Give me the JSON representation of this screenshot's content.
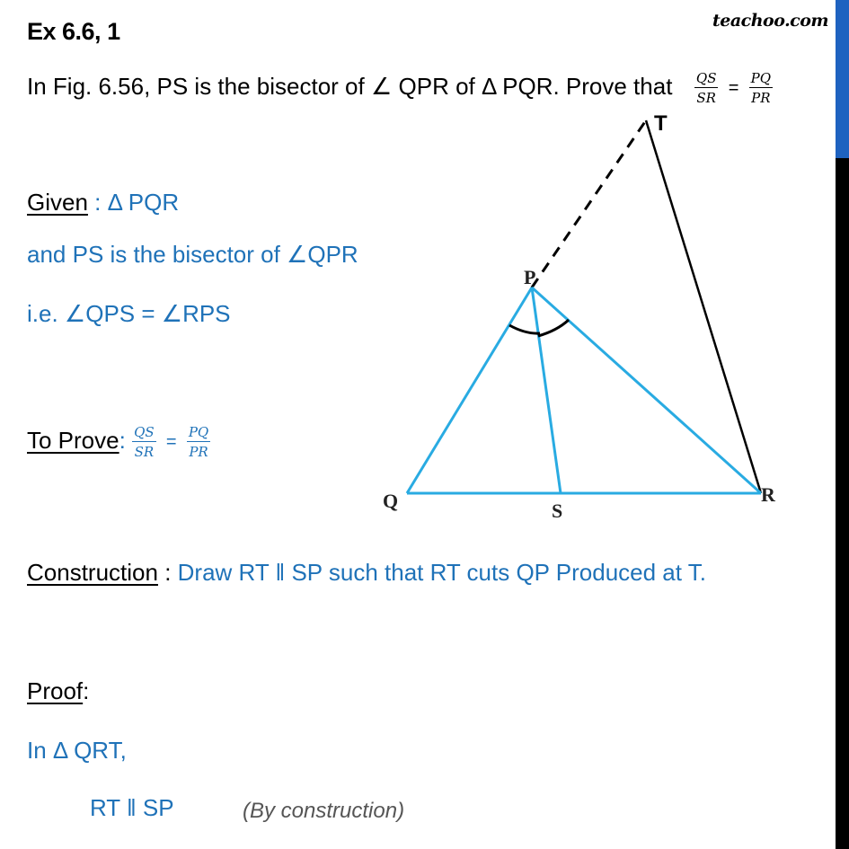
{
  "header": {
    "title": "Ex 6.6, 1",
    "brand": "teachoo.com"
  },
  "question": {
    "text": "In Fig. 6.56, PS is the bisector of ∠ QPR of Δ PQR. Prove that",
    "fraction_left": {
      "num": "QS",
      "den": "SR"
    },
    "equals": "=",
    "fraction_right": {
      "num": "PQ",
      "den": "PR"
    }
  },
  "given": {
    "label": "Given",
    "separator": " : ",
    "value": "Δ PQR",
    "line2": "and PS is the bisector of ∠QPR",
    "line3": "i.e. ∠QPS = ∠RPS"
  },
  "to_prove": {
    "label": "To Prove",
    "separator": ":",
    "fraction_left": {
      "num": "QS",
      "den": "SR"
    },
    "equals": "=",
    "fraction_right": {
      "num": "PQ",
      "den": "PR"
    }
  },
  "construction": {
    "label": "Construction",
    "separator": " : ",
    "value": "Draw RT ‖ SP such that RT cuts QP Produced  at T."
  },
  "proof": {
    "label": "Proof",
    "separator": ":",
    "line1": "In Δ QRT,",
    "line2": "RT  ‖ SP",
    "line2_reason": "(By construction)"
  },
  "figure": {
    "labels": {
      "P": "P",
      "Q": "Q",
      "R": "R",
      "S": "S",
      "T": "T"
    },
    "colors": {
      "triangle": "#29abe2",
      "construction": "#000000",
      "angle_arcs": "#000000"
    }
  },
  "scrollbar": {
    "thumb_color": "#1e62c0",
    "track_color": "#000000"
  }
}
